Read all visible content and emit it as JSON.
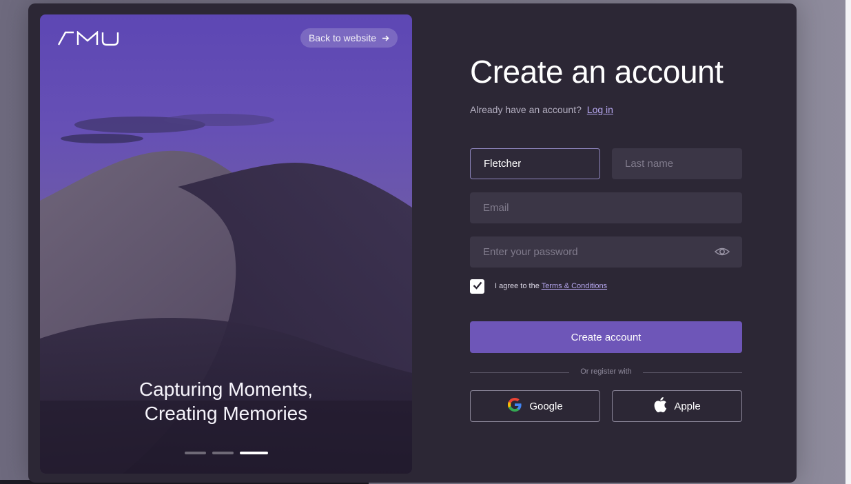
{
  "brand": {
    "logo_text": "AMU"
  },
  "hero": {
    "back_label": "Back to website",
    "tagline_line1": "Capturing Moments,",
    "tagline_line2": "Creating Memories",
    "slides": 3,
    "active_slide": 3
  },
  "form": {
    "title": "Create an account",
    "have_account": "Already have an account?",
    "login_link": "Log in",
    "first_name_value": "Fletcher",
    "last_name_placeholder": "Last name",
    "email_placeholder": "Email",
    "password_placeholder": "Enter your password",
    "agree_prefix": "I agree to the",
    "terms_link": "Terms & Conditions",
    "agree_checked": true,
    "submit_label": "Create account",
    "divider_label": "Or register with",
    "google_label": "Google",
    "apple_label": "Apple"
  },
  "icons": {
    "back": "arrow-right-icon",
    "eye": "eye-icon",
    "check": "check-icon",
    "google": "google-icon",
    "apple": "apple-icon"
  },
  "colors": {
    "accent": "#6e56b8",
    "link": "#b7a8f0",
    "card": "#2c2735",
    "field": "#3b3646"
  }
}
